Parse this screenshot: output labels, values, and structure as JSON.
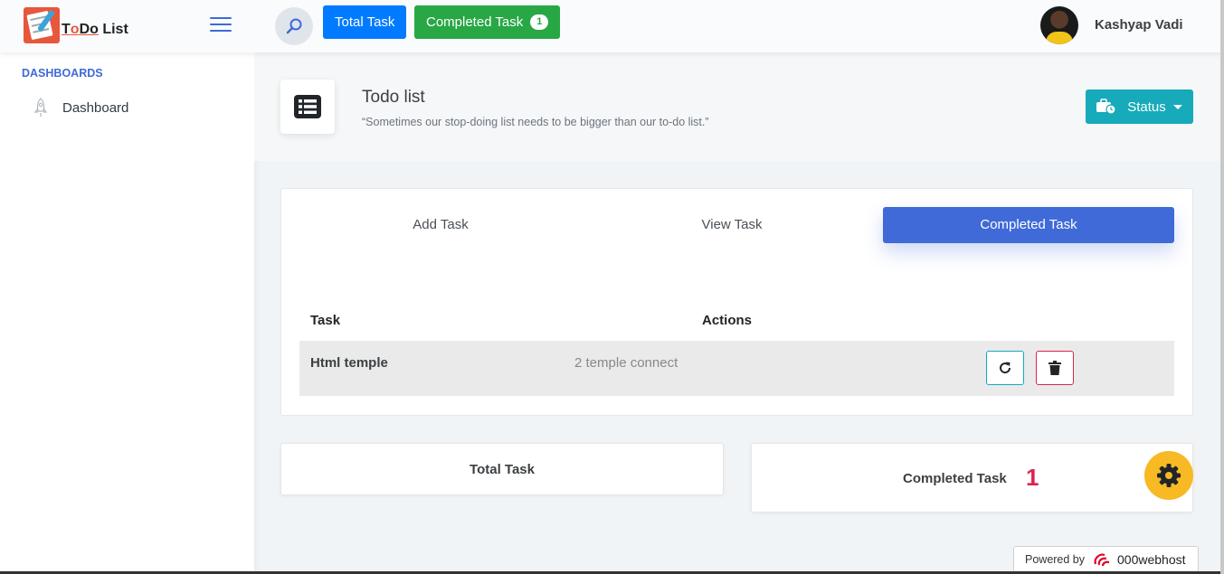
{
  "header": {
    "logo_text_prefix": "o",
    "logo_text_mid": "Do",
    "logo_text_suffix": " List",
    "logo_letter": "T",
    "total_task_label": "Total Task",
    "completed_task_label": "Completed Task",
    "completed_badge": "1",
    "user_name": "Kashyap Vadi"
  },
  "sidebar": {
    "heading": "DASHBOARDS",
    "items": [
      {
        "label": "Dashboard",
        "icon": "rocket-icon"
      }
    ]
  },
  "page": {
    "title": "Todo list",
    "subtitle": "“Sometimes our stop-doing list needs to be bigger than our to-do list.”",
    "status_label": "Status"
  },
  "tabs": [
    {
      "label": "Add Task",
      "active": false
    },
    {
      "label": "View Task",
      "active": false
    },
    {
      "label": "Completed Task",
      "active": true
    }
  ],
  "table": {
    "columns": [
      "Task",
      "Actions"
    ],
    "rows": [
      {
        "task": "Html temple",
        "description": "2 temple connect"
      }
    ]
  },
  "cards": {
    "total_label": "Total Task",
    "completed_label": "Completed Task",
    "completed_count": "1"
  },
  "footer": {
    "powered_by": "Powered by",
    "host": "000webhost"
  },
  "colors": {
    "primary": "#3f6ad8",
    "info": "#16aaba",
    "success": "#28a745",
    "blue": "#007bff",
    "danger": "#d92550",
    "warning": "#f7b924"
  }
}
